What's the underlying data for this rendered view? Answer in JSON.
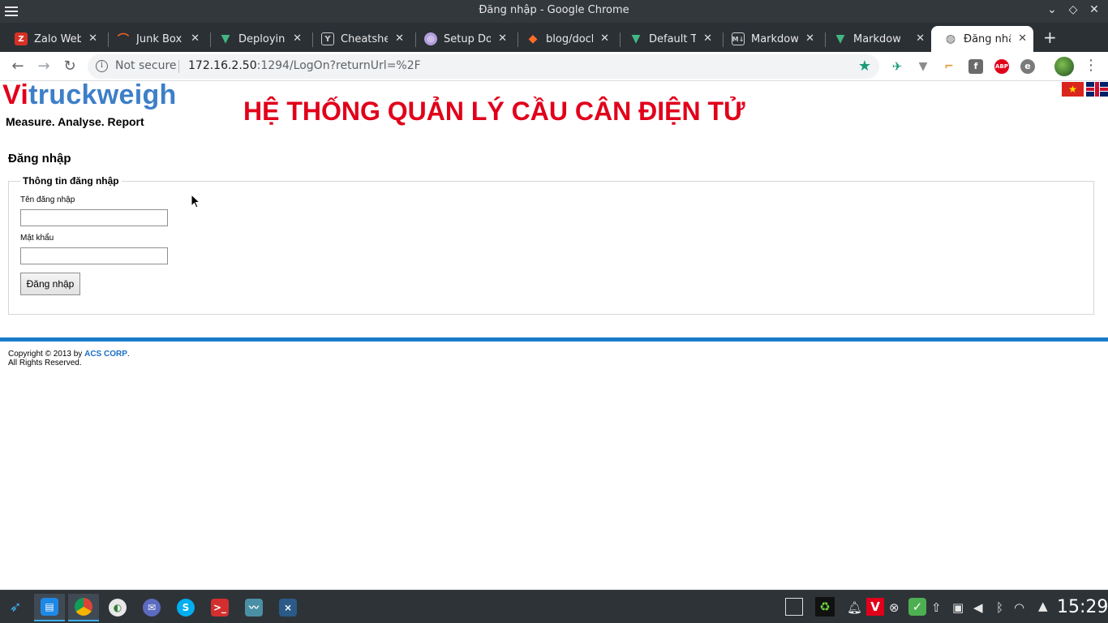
{
  "window": {
    "title": "Đăng nhập - Google Chrome",
    "controls": [
      "⌄",
      "◇",
      "✕"
    ]
  },
  "tabs": [
    {
      "label": "Zalo Web",
      "icon": "zalo-icon",
      "color": "#d93025"
    },
    {
      "label": "Junk Box",
      "icon": "junkbox-icon",
      "color": "#f26522"
    },
    {
      "label": "Deploying",
      "icon": "vue-icon",
      "color": "#41b883"
    },
    {
      "label": "Cheatshee",
      "icon": "cheatsheet-icon",
      "color": "#cccccc"
    },
    {
      "label": "Setup Doc",
      "icon": "setup-doc-icon",
      "color": "#b39ddb"
    },
    {
      "label": "blog/dock",
      "icon": "gitlab-icon",
      "color": "#fc6d26"
    },
    {
      "label": "Default Th",
      "icon": "vue-icon",
      "color": "#41b883"
    },
    {
      "label": "Markdow",
      "icon": "markdown-icon",
      "color": "#cccccc"
    },
    {
      "label": "Markdow",
      "icon": "vue-icon",
      "color": "#41b883"
    },
    {
      "label": "Đăng nhập",
      "icon": "globe-icon",
      "color": "#5f6368"
    }
  ],
  "toolbar": {
    "security": "Not secure",
    "url_host": "172.16.2.50",
    "url_rest": ":1294/LogOn?returnUrl=%2F"
  },
  "page": {
    "logo_vi": "Vi",
    "logo_rest": "truckweigh",
    "tagline": "Measure. Analyse. Report",
    "headline": "HỆ THỐNG QUẢN LÝ CẦU CÂN ĐIỆN TỬ",
    "title": "Đăng nhập",
    "legend": "Thông tin đăng nhập",
    "username_label": "Tên đăng nhập",
    "password_label": "Mật khẩu",
    "username_value": "",
    "password_value": "",
    "submit_label": "Đăng nhập",
    "copyright_prefix": "Copyright © 2013 by ",
    "copyright_corp": "ACS CORP",
    "copyright_suffix": ".",
    "rights": "All Rights Reserved."
  },
  "taskbar": {
    "clock": "15:29"
  },
  "colors": {
    "brand_red": "#e1001a",
    "brand_blue": "#3d7fc8",
    "footer_bar": "#1a7bc9"
  }
}
